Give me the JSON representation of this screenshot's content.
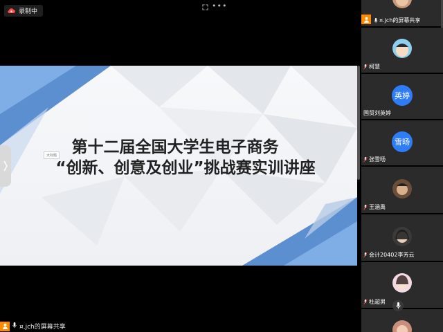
{
  "recording": {
    "label": "录制中"
  },
  "slide": {
    "title_line1": "第十二届全国大学生电子商务",
    "title_line2": "“创新、创意及创业”挑战赛实训讲座",
    "tooltip": "大标题"
  },
  "share_bar": {
    "label": "¤.jch的屏幕共享"
  },
  "participants": [
    {
      "name": "¤.jch的屏幕共享"
    },
    {
      "name": "柯慧"
    },
    {
      "name": "国贸刘英婷",
      "avatar_text": "英婷",
      "avatar_color": "#2e7cf6"
    },
    {
      "name": "张雪旸",
      "avatar_text": "雪旸",
      "avatar_color": "#2e7cf6"
    },
    {
      "name": "王涵禹"
    },
    {
      "name": "会计20402李芳云"
    },
    {
      "name": "杜超男"
    }
  ],
  "colors": {
    "host_badge": "#ff8a00",
    "avatar_blue": "#2e7cf6",
    "tile_bg": "#2b2b2b"
  }
}
